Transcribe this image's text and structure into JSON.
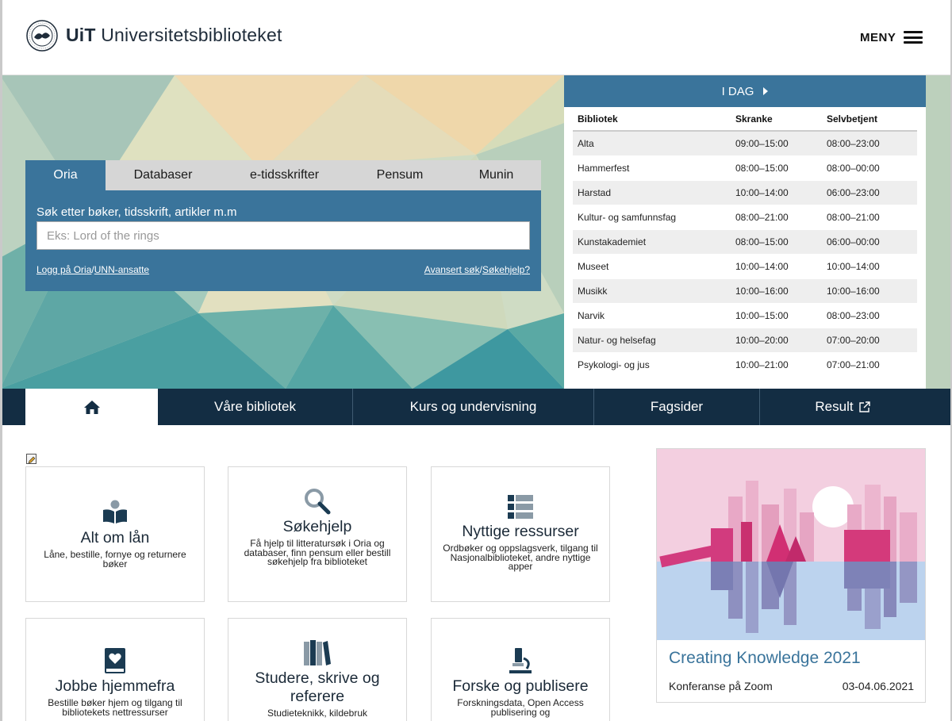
{
  "header": {
    "logo_strong": "UiT",
    "logo_rest": " Universitetsbiblioteket",
    "menu_label": "MENY"
  },
  "search": {
    "tabs": [
      "Oria",
      "Databaser",
      "e-tidsskrifter",
      "Pensum",
      "Munin"
    ],
    "active_tab": "Oria",
    "label": "Søk etter bøker, tidsskrift, artikler m.m",
    "placeholder": "Eks: Lord of the rings",
    "value": "",
    "link_login": "Logg på Oria",
    "link_sep": "/",
    "link_unn": "UNN-ansatte",
    "link_advanced": "Avansert søk",
    "link_help": "Søkehjelp?"
  },
  "hours": {
    "title": "I DAG",
    "columns": [
      "Bibliotek",
      "Skranke",
      "Selvbetjent"
    ],
    "rows": [
      [
        "Alta",
        "09:00–15:00",
        "08:00–23:00"
      ],
      [
        "Hammerfest",
        "08:00–15:00",
        "08:00–00:00"
      ],
      [
        "Harstad",
        "10:00–14:00",
        "06:00–23:00"
      ],
      [
        "Kultur- og samfunnsfag",
        "08:00–21:00",
        "08:00–21:00"
      ],
      [
        "Kunstakademiet",
        "08:00–15:00",
        "06:00–00:00"
      ],
      [
        "Museet",
        "10:00–14:00",
        "10:00–14:00"
      ],
      [
        "Musikk",
        "10:00–16:00",
        "10:00–16:00"
      ],
      [
        "Narvik",
        "10:00–15:00",
        "08:00–23:00"
      ],
      [
        "Natur- og helsefag",
        "10:00–20:00",
        "07:00–20:00"
      ],
      [
        "Psykologi- og jus",
        "10:00–21:00",
        "07:00–21:00"
      ]
    ]
  },
  "nav": {
    "items": [
      "Våre bibliotek",
      "Kurs og undervisning",
      "Fagsider",
      "Result"
    ]
  },
  "cards": [
    {
      "title": "Alt om lån",
      "desc": "Låne, bestille, fornye og returnere bøker",
      "icon": "reader-icon"
    },
    {
      "title": "Søkehjelp",
      "desc": "Få hjelp til litteratursøk i Oria og databaser, finn pensum eller bestill søkehjelp fra biblioteket",
      "icon": "search-icon"
    },
    {
      "title": "Nyttige ressurser",
      "desc": "Ordbøker og oppslagsverk, tilgang til Nasjonalbiblioteket, andre nyttige apper",
      "icon": "list-icon"
    },
    {
      "title": "Jobbe hjemmefra",
      "desc": "Bestille bøker hjem og tilgang til bibliotekets nettressurser",
      "icon": "heart-book-icon"
    },
    {
      "title": "Studere, skrive og referere",
      "desc": "Studieteknikk, kildebruk",
      "icon": "books-icon"
    },
    {
      "title": "Forske og publisere",
      "desc": "Forskningsdata, Open Access publisering og",
      "icon": "microscope-icon"
    }
  ],
  "event": {
    "title": "Creating Knowledge 2021",
    "subtitle": "Konferanse på Zoom",
    "date": "03-04.06.2021"
  },
  "colors": {
    "primary": "#3a749b",
    "navbar": "#132d43",
    "icon": "#1b3b52"
  }
}
